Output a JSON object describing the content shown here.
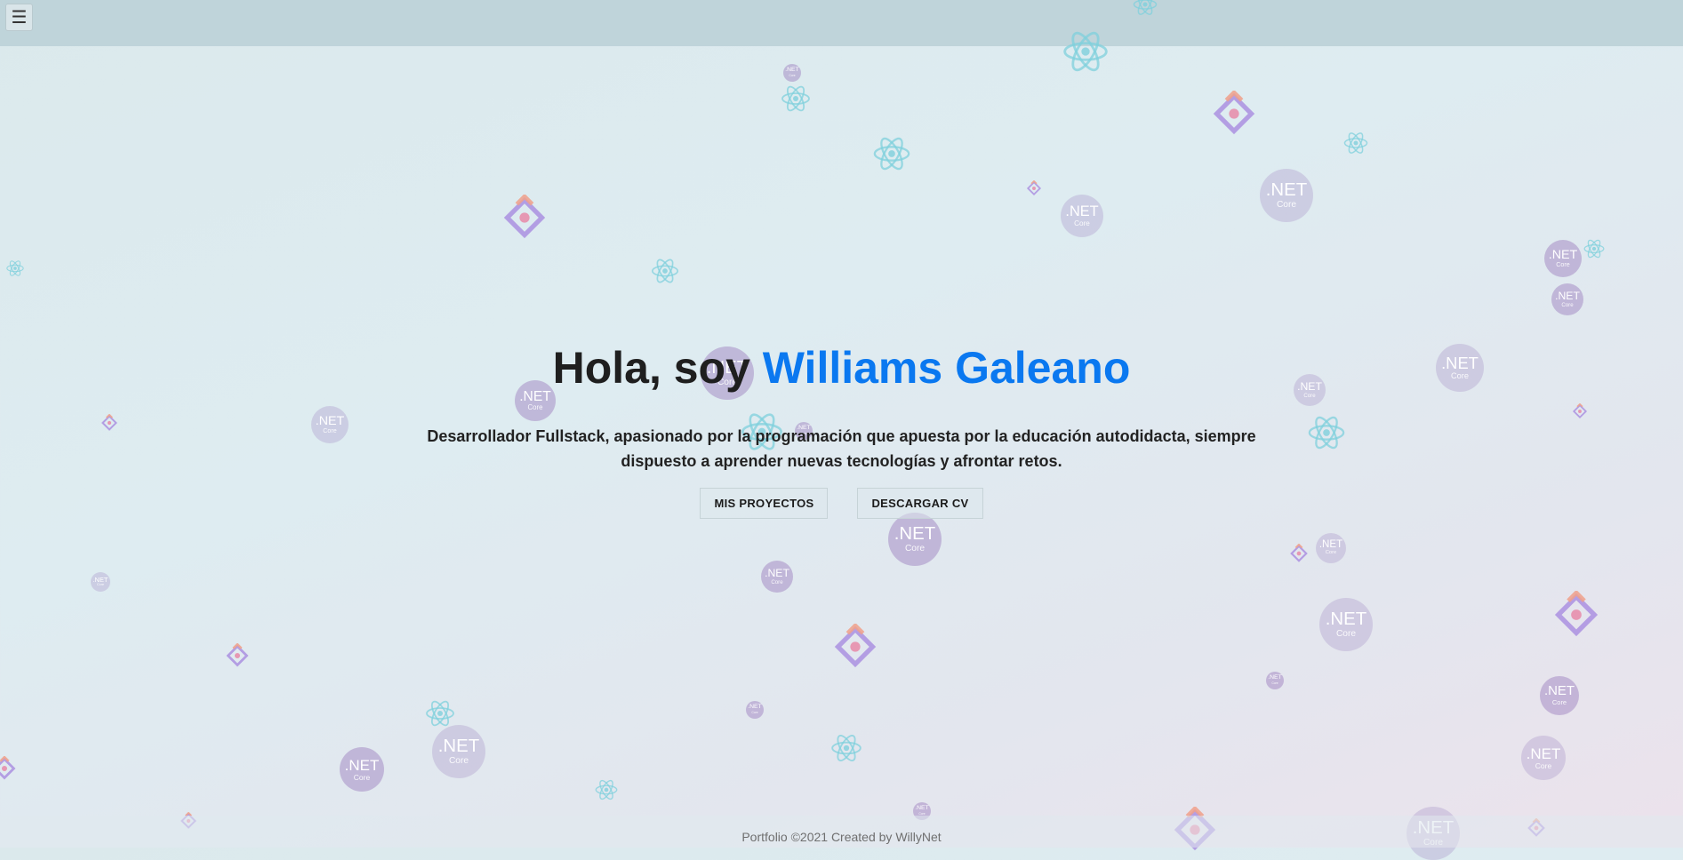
{
  "header": {
    "menu_icon": "hamburger-menu-icon",
    "menu_glyph": "☰"
  },
  "hero": {
    "greeting": "Hola, soy ",
    "name": "Williams Galeano",
    "description": "Desarrollador Fullstack, apasionado por la programación que apuesta por la educación autodidacta, siempre dispuesto a aprender nuevas tecnologías y afrontar retos.",
    "buttons": {
      "projects": "MIS PROYECTOS",
      "cv": "DESCARGAR CV"
    }
  },
  "footer": {
    "text": "Portfolio ©2021 Created by WillyNet"
  },
  "background": {
    "net_label": ".NET",
    "net_sub": "Core",
    "icons": [
      "dotnet-core-icon",
      "react-icon",
      "ionic-diamond-icon"
    ]
  },
  "colors": {
    "accent": "#0a78f0",
    "topbar": "#bfd4da",
    "text": "#1f1f1f",
    "footer_text": "#6f6f6f"
  }
}
